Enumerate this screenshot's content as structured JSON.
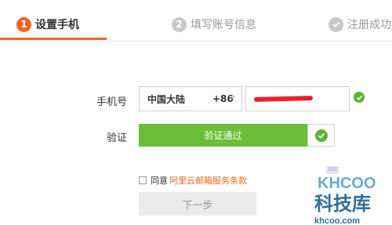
{
  "steps": [
    {
      "num": "1",
      "label": "设置手机"
    },
    {
      "num": "2",
      "label": "填写账号信息"
    },
    {
      "num": "",
      "label": "注册成功"
    }
  ],
  "form": {
    "phone_label": "手机号",
    "region_country": "中国大陆",
    "region_code": "+86",
    "phone_value": "",
    "verify_label": "验证",
    "verify_status": "验证通过"
  },
  "agreement": {
    "prefix": "同意",
    "link": "阿里云邮箱服务条款"
  },
  "next_button": "下一步",
  "watermark": {
    "brand": "KHCOO",
    "cn": "科技库",
    "site": "khcoo.com"
  },
  "colors": {
    "accent": "#f26522",
    "success": "#6abe39",
    "muted": "#c8c8c8"
  }
}
